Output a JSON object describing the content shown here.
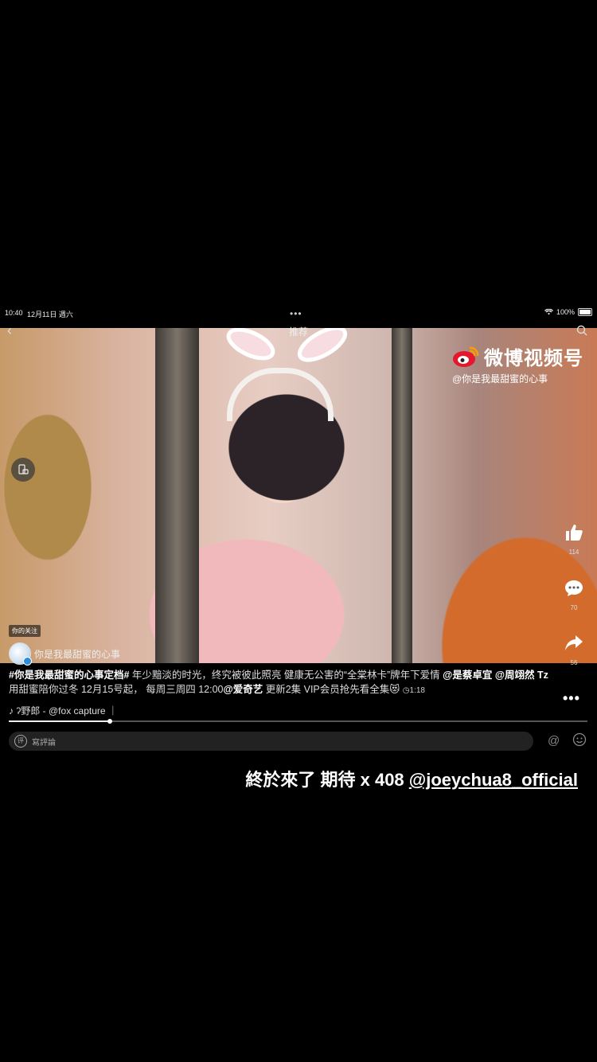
{
  "status_bar": {
    "time": "10:40",
    "date": "12月11日 週六",
    "battery": "100%"
  },
  "header": {
    "title": "推荐"
  },
  "watermark": {
    "brand": "微博视频号",
    "account": "@你是我最甜蜜的心事"
  },
  "actions": {
    "likes": "114",
    "comments": "70",
    "shares": "56"
  },
  "follow_badge": "你的关注",
  "author": {
    "name": "你是我最甜蜜的心事"
  },
  "caption": {
    "hashtag": "#你是我最甜蜜的心事定档#",
    "text1": " 年少黯淡的时光，终究被彼此照亮 健康无公害的“全棠林卡”牌年下爱情 ",
    "mention1": "@是蔡卓宜",
    "mention2": "@周翊然 Tz",
    "text2": " 用甜蜜陪你过冬 12月15号起， 每周三周四 12:00",
    "mention3": "@爱奇艺",
    "text3": " 更新2集 VIP会员抢先看全集",
    "emoji": "😻",
    "time": "1:18"
  },
  "music": {
    "text": "♪ ʔ野郎 - @fox capture ｜"
  },
  "playback": {
    "progress": 0.175
  },
  "comment_bar": {
    "icon_text": "评",
    "placeholder": "寫評論"
  },
  "overlay": {
    "text": "終於來了 期待 x 408 ",
    "handle": "@joeychua8_official"
  },
  "colors": {
    "background": "#000000",
    "verified": "#2f8cd8",
    "weibo_red": "#e6162d",
    "weibo_orange": "#ff9c00"
  }
}
